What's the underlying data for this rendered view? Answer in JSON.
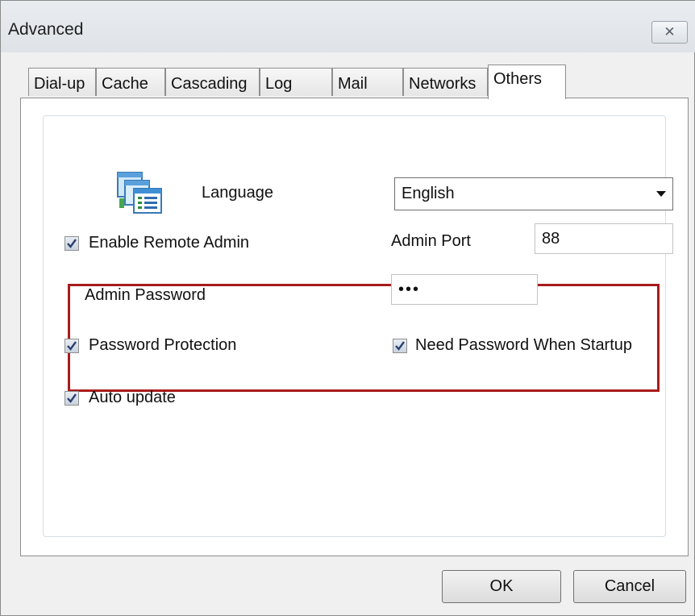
{
  "window": {
    "title": "Advanced"
  },
  "tabs": [
    {
      "label": "Dial-up"
    },
    {
      "label": "Cache"
    },
    {
      "label": "Cascading"
    },
    {
      "label": "Log"
    },
    {
      "label": "Mail"
    },
    {
      "label": "Networks"
    },
    {
      "label": "Others",
      "active": true
    }
  ],
  "others": {
    "language_label": "Language",
    "language_value": "English",
    "enable_remote_admin": {
      "label": "Enable Remote Admin",
      "checked": true
    },
    "admin_port_label": "Admin Port",
    "admin_port_value": "88",
    "admin_password_label": "Admin Password",
    "admin_password_value": "•••",
    "password_protection": {
      "label": "Password Protection",
      "checked": true
    },
    "need_password_startup": {
      "label": "Need Password When Startup",
      "checked": true
    },
    "auto_update": {
      "label": "Auto update",
      "checked": true
    }
  },
  "buttons": {
    "ok": "OK",
    "cancel": "Cancel"
  },
  "colors": {
    "highlight_border": "#a81c1c",
    "check_mark": "#2b3f70"
  },
  "icons": {
    "close": "close-icon",
    "language": "language-icon",
    "dropdown": "chevron-down-icon"
  }
}
